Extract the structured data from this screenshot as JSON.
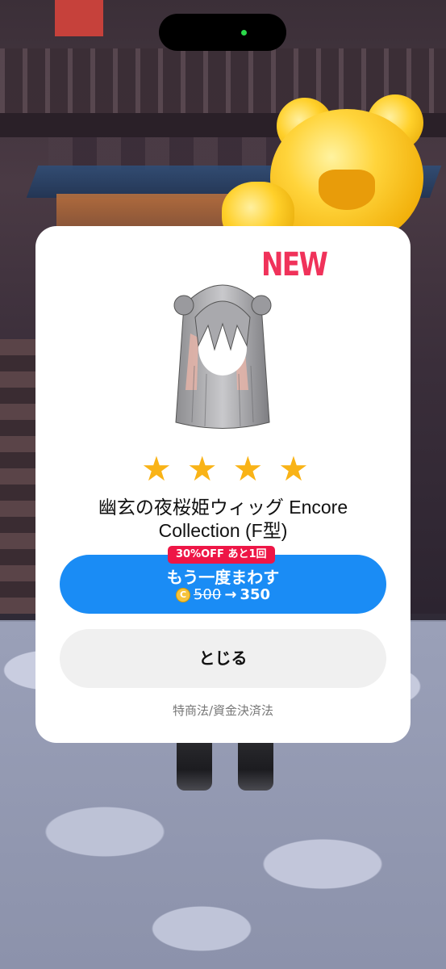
{
  "modal": {
    "badge": "NEW",
    "rarity_stars": 4,
    "star_glyph": "★",
    "item_title": "幽玄の夜桜姫ウィッグ Encore Collection (F型)",
    "discount_badge": "30%OFF あと1回",
    "retry_label": "もう一度まわす",
    "coin_icon": "coin-icon",
    "coin_symbol": "C",
    "old_price": "500",
    "arrow": "→",
    "new_price": "350",
    "close_label": "とじる",
    "legal_link": "特商法/資金決済法"
  },
  "colors": {
    "primary_button": "#1a8cf5",
    "discount_badge": "#ee1646",
    "new_badge": "#f0325a",
    "star": "#f9b316",
    "close_button": "#f0f0f0"
  }
}
